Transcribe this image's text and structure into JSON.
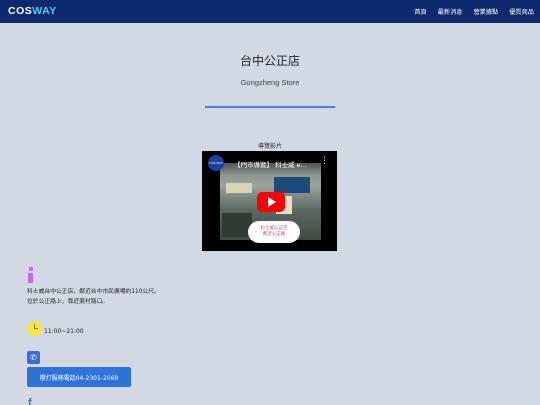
{
  "header": {
    "logo": {
      "part1": "COS",
      "part2": "WAY"
    },
    "nav": [
      "首頁",
      "最新消息",
      "營業據點",
      "優質商品"
    ]
  },
  "store": {
    "title": "台中公正店",
    "subtitle": "Gongzheng Store"
  },
  "video": {
    "label": "導覽影片",
    "title": "【門市導覽】 科士威 e...",
    "channel": "COS WAY",
    "overlay_lines": [
      "科士威公正店",
      "鄰近公正路"
    ]
  },
  "info": {
    "line1": "科士威台中公正店，鄰近台中市民廣場約110公尺。",
    "line2": "位於公正路上，靠近美村路口。"
  },
  "hours": "11:00~21:00",
  "call_button": "撥打服務電話04-2301-2069",
  "colors": {
    "navbar": "#0d2a6e",
    "accent": "#4b7bec",
    "button": "#2f73d8",
    "page_bg": "#d3d8e5"
  }
}
